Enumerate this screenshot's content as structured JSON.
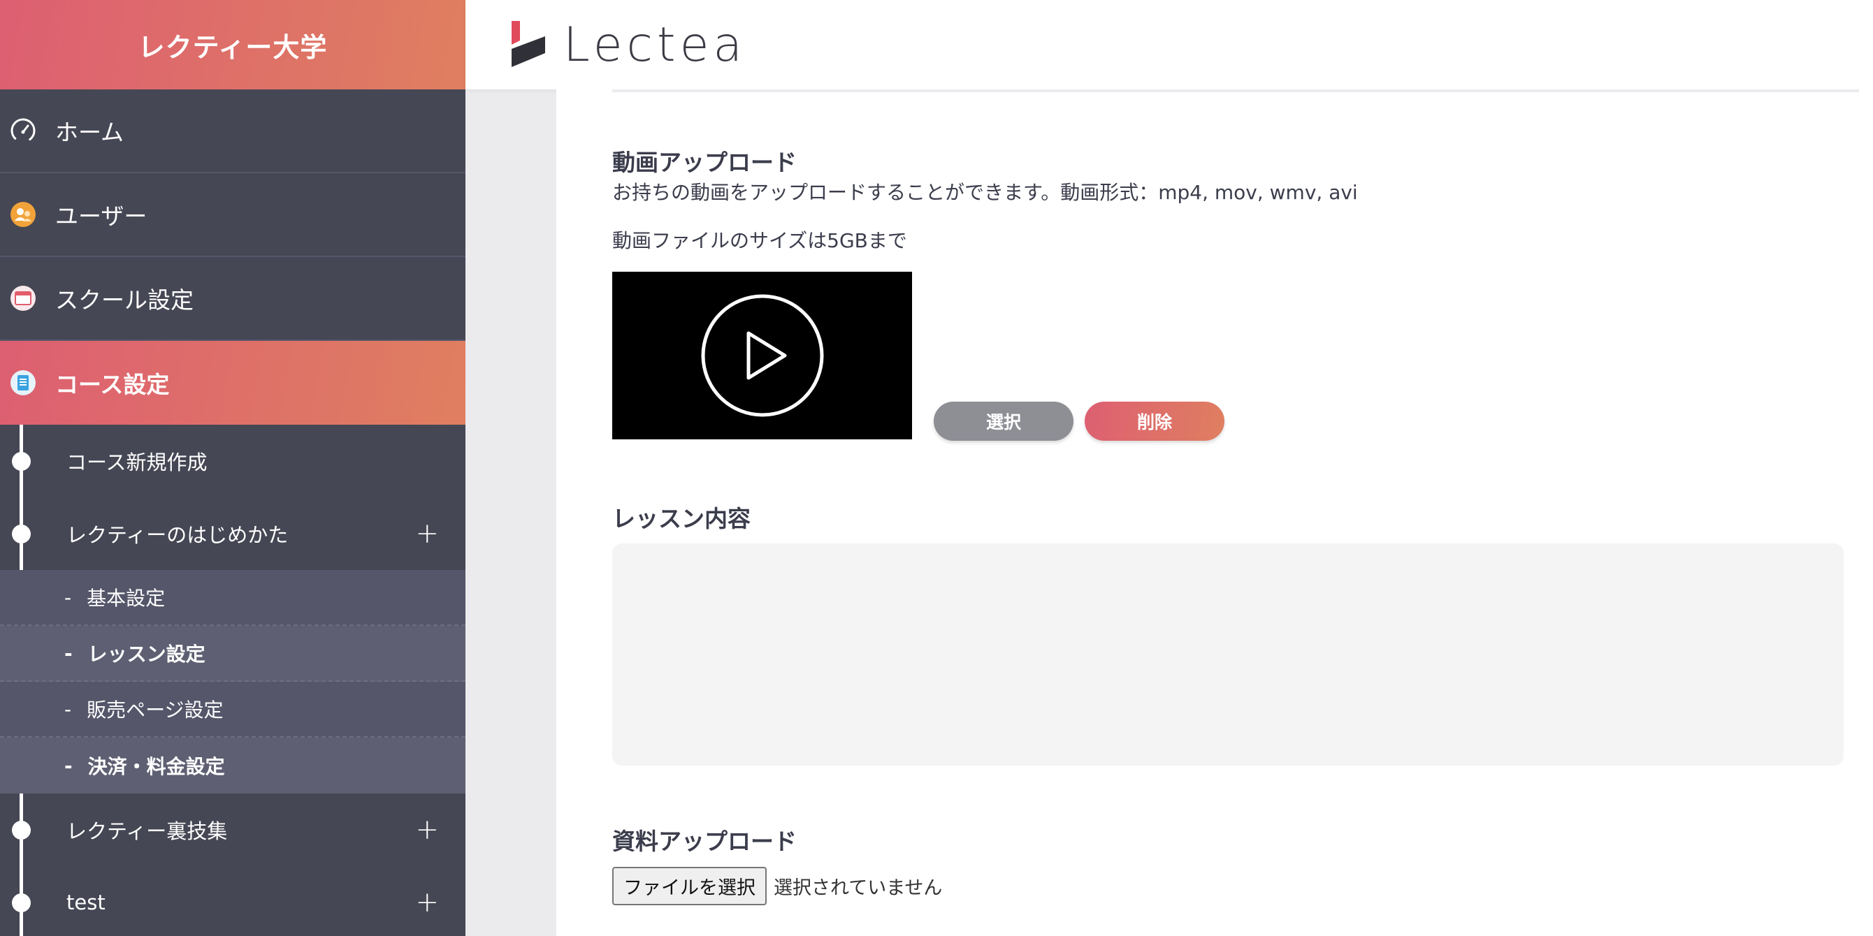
{
  "sidebar": {
    "brand": "レクティー大学",
    "nav": [
      {
        "label": "ホーム",
        "icon": "dashboard-gauge-icon"
      },
      {
        "label": "ユーザー",
        "icon": "users-icon"
      },
      {
        "label": "スクール設定",
        "icon": "browser-window-icon"
      },
      {
        "label": "コース設定",
        "icon": "document-icon",
        "active": true
      }
    ],
    "courses": [
      {
        "label": "コース新規作成"
      },
      {
        "label": "レクティーのはじめかた",
        "expand": "+"
      }
    ],
    "lessons": [
      {
        "dash": "-",
        "label": "基本設定"
      },
      {
        "dash": "-",
        "label": "レッスン設定"
      },
      {
        "dash": "-",
        "label": "販売ページ設定"
      },
      {
        "dash": "-",
        "label": "決済・料金設定"
      }
    ],
    "courses_after": [
      {
        "label": "レクティー裏技集",
        "expand": "+"
      },
      {
        "label": "test",
        "expand": "+"
      }
    ]
  },
  "header": {
    "logo_text": "Lectea"
  },
  "video_upload": {
    "title": "動画アップロード",
    "description": "お持ちの動画をアップロードすることができます。動画形式：mp4, mov, wmv, avi",
    "size_note": "動画ファイルのサイズは5GBまで",
    "select_label": "選択",
    "delete_label": "削除"
  },
  "lesson_content": {
    "title": "レッスン内容",
    "value": ""
  },
  "material_upload": {
    "title": "資料アップロード",
    "file_button": "ファイルを選択",
    "file_status": "選択されていません"
  },
  "colors": {
    "accent_gradient_start": "#dd5f72",
    "accent_gradient_end": "#df7f60",
    "sidebar_bg": "#464754",
    "select_button": "#8e8f95"
  }
}
